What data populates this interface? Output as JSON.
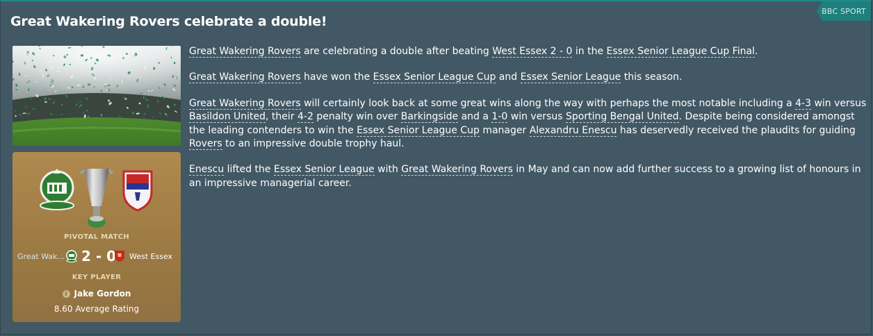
{
  "headline": "Great Wakering Rovers celebrate a double!",
  "source_label": "BBC SPORT",
  "pivotal_match": {
    "label": "PIVOTAL MATCH",
    "home_team": "Great Wak...",
    "score": "2 - 0",
    "away_team": "West Essex"
  },
  "key_player": {
    "label": "KEY PLAYER",
    "name": "Jake Gordon",
    "rating": "8.60 Average Rating"
  },
  "paragraphs": [
    [
      {
        "text": "Great Wakering Rovers",
        "link": true
      },
      {
        "text": " are celebrating a double after beating ",
        "link": false
      },
      {
        "text": "West Essex 2 - 0",
        "link": true
      },
      {
        "text": " in the ",
        "link": false
      },
      {
        "text": "Essex Senior League Cup Final",
        "link": true
      },
      {
        "text": ".",
        "link": false
      }
    ],
    [
      {
        "text": "Great Wakering Rovers",
        "link": true
      },
      {
        "text": " have won the ",
        "link": false
      },
      {
        "text": "Essex Senior League Cup",
        "link": true
      },
      {
        "text": " and ",
        "link": false
      },
      {
        "text": "Essex Senior League",
        "link": true
      },
      {
        "text": " this season.",
        "link": false
      }
    ],
    [
      {
        "text": "Great Wakering Rovers",
        "link": true
      },
      {
        "text": " will certainly look back at some great wins along the way with perhaps the most notable including a ",
        "link": false
      },
      {
        "text": "4-3",
        "link": true
      },
      {
        "text": " win versus ",
        "link": false
      },
      {
        "text": "Basildon United",
        "link": true
      },
      {
        "text": ", their ",
        "link": false
      },
      {
        "text": "4-2",
        "link": true
      },
      {
        "text": " penalty win over ",
        "link": false
      },
      {
        "text": "Barkingside",
        "link": true
      },
      {
        "text": " and a ",
        "link": false
      },
      {
        "text": "1-0",
        "link": true
      },
      {
        "text": " win versus ",
        "link": false
      },
      {
        "text": "Sporting Bengal United",
        "link": true
      },
      {
        "text": ". Despite being considered amongst the leading contenders to win the ",
        "link": false
      },
      {
        "text": "Essex Senior League Cup",
        "link": true
      },
      {
        "text": " manager ",
        "link": false
      },
      {
        "text": "Alexandru Enescu",
        "link": true
      },
      {
        "text": " has deservedly received the plaudits for guiding ",
        "link": false
      },
      {
        "text": "Rovers",
        "link": true
      },
      {
        "text": " to an impressive double trophy haul.",
        "link": false
      }
    ],
    [
      {
        "text": "Enescu",
        "link": true
      },
      {
        "text": " lifted the ",
        "link": false
      },
      {
        "text": "Essex Senior League",
        "link": true
      },
      {
        "text": " with ",
        "link": false
      },
      {
        "text": "Great Wakering Rovers",
        "link": true
      },
      {
        "text": " in May and can now add further success to a growing list of honours in an impressive managerial career.",
        "link": false
      }
    ]
  ]
}
